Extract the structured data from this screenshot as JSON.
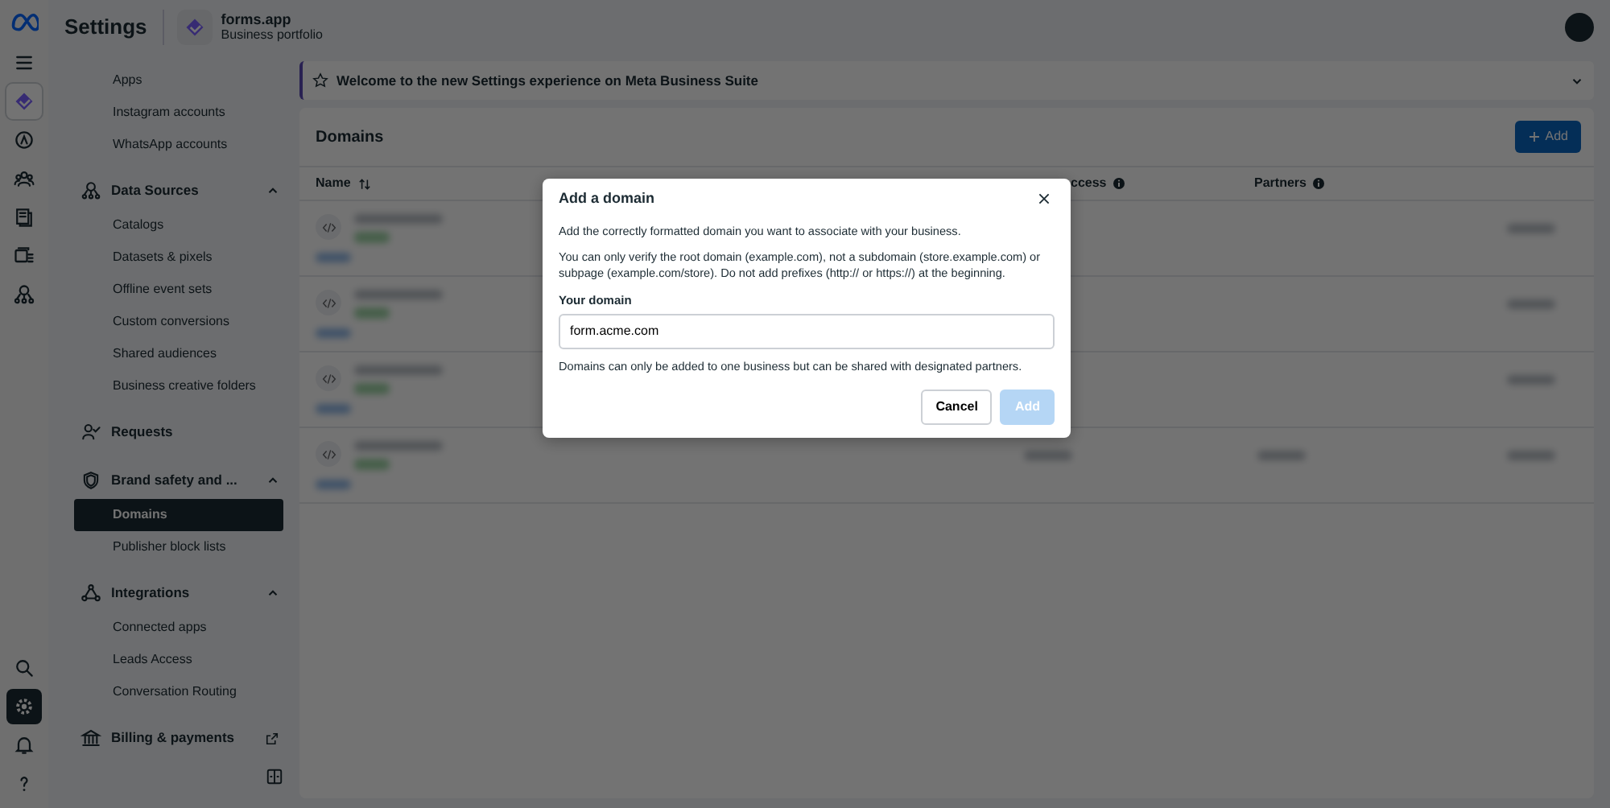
{
  "header": {
    "title": "Settings",
    "business_name": "forms.app",
    "business_type": "Business portfolio"
  },
  "rail_top": [
    {
      "kind": "meta",
      "selected": false
    },
    {
      "kind": "menu",
      "selected": false
    },
    {
      "kind": "app",
      "selected": true
    },
    {
      "kind": "compass",
      "selected": false
    },
    {
      "kind": "people",
      "selected": false
    },
    {
      "kind": "pages",
      "selected": false
    },
    {
      "kind": "ads",
      "selected": false
    },
    {
      "kind": "sources",
      "selected": false
    }
  ],
  "rail_bottom": [
    {
      "kind": "search",
      "selected": false
    },
    {
      "kind": "settings",
      "selected": true
    },
    {
      "kind": "bell",
      "selected": false
    },
    {
      "kind": "help",
      "selected": false
    }
  ],
  "sidebar": [
    {
      "kind": "item",
      "label": "Apps",
      "selected": false
    },
    {
      "kind": "item",
      "label": "Instagram accounts",
      "selected": false
    },
    {
      "kind": "item",
      "label": "WhatsApp accounts",
      "selected": false
    },
    {
      "kind": "sources_group",
      "label": "Data Sources",
      "expanded": true,
      "items": [
        {
          "label": "Catalogs",
          "selected": false
        },
        {
          "label": "Datasets & pixels",
          "selected": false
        },
        {
          "label": "Offline event sets",
          "selected": false
        },
        {
          "label": "Custom conversions",
          "selected": false
        },
        {
          "label": "Shared audiences",
          "selected": false
        },
        {
          "label": "Business creative folders",
          "selected": false
        }
      ]
    },
    {
      "kind": "requests_link",
      "label": "Requests"
    },
    {
      "kind": "shield_group",
      "label": "Brand safety and ...",
      "expanded": true,
      "items": [
        {
          "label": "Domains",
          "selected": true
        },
        {
          "label": "Publisher block lists",
          "selected": false
        }
      ]
    },
    {
      "kind": "integrations_group",
      "label": "Integrations",
      "expanded": true,
      "items": [
        {
          "label": "Connected apps",
          "selected": false
        },
        {
          "label": "Leads Access",
          "selected": false
        },
        {
          "label": "Conversation Routing",
          "selected": false
        }
      ]
    },
    {
      "kind": "billing_external",
      "label": "Billing & payments"
    }
  ],
  "banner": {
    "text": "Welcome to the new Settings experience on Meta Business Suite",
    "expanded": false
  },
  "domains": {
    "title": "Domains",
    "add_label": "Add",
    "columns": [
      {
        "label": "Name",
        "kind": "sortable"
      },
      {
        "label": "ccess",
        "kind": "info"
      },
      {
        "label": "Partners",
        "kind": "info"
      }
    ],
    "rows": [
      {
        "kind": "under_dialog"
      },
      {
        "kind": "under_dialog"
      },
      {
        "kind": "under_dialog"
      },
      {
        "kind": "blurred"
      }
    ]
  },
  "modal": {
    "title": "Add a domain",
    "paragraphs": [
      "Add the correctly formatted domain you want to associate with your business.",
      "You can only verify the root domain (example.com), not a subdomain (store.example.com) or subpage (example.com/store). Do not add prefixes (http:// or https://) at the beginning."
    ],
    "field_label": "Your domain",
    "field_value": "form.acme.com",
    "note": "Domains can only be added to one business but can be shared with designated partners.",
    "buttons": [
      {
        "label": "Cancel",
        "kind": "secondary",
        "disabled": false
      },
      {
        "label": "Add",
        "kind": "primary",
        "disabled": true
      }
    ]
  }
}
